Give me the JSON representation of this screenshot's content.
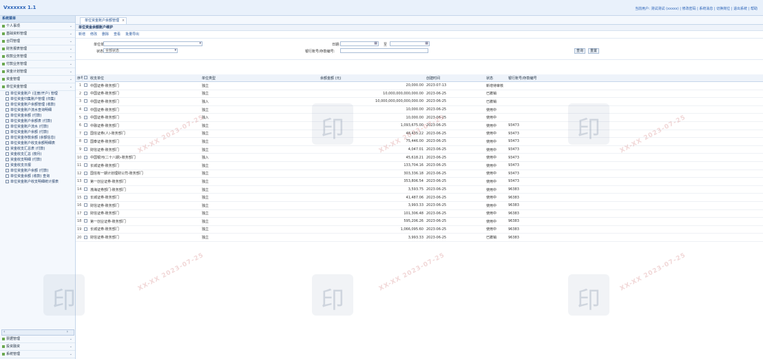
{
  "app": {
    "title": "Vxxxxxx 1.1"
  },
  "top_links": "当前用户: 测试测试 (xxxxx) | 修改密码 | 系统消息 | 切换岗位 | 退出系统 | 帮助",
  "sidebar": {
    "header": "系统菜单",
    "menu": [
      "个人事项",
      "基础资料管理",
      "合同管理",
      "财务报表管理",
      "收款业务管理",
      "付款业务管理",
      "资金计划管理",
      "资金管理",
      "单位资金管理"
    ],
    "submenu": [
      "单位资金账户 (注册/开户) 管理",
      "单位资金归集账户管理 (归集)",
      "单位资金账户余额管理 (收款)",
      "单位资金账户流水查询明细",
      "单位资金余额 (付款)",
      "单位资金账户余额表 (付款)",
      "单位资金账户流水 (付款)",
      "单位资金账户余额 (付款)",
      "单位资金存款余额 (余额信息)",
      "单位资金账户收支余额明细表",
      "资金收支汇总表 (付款)",
      "资金收支汇总 (按月)",
      "资金收支明细 (付款)",
      "资金收支日报",
      "单位资金账户余额 (付款)",
      "单位资金余额 (收款) 查询",
      "单位资金账户收支明细统计报表"
    ],
    "bottom_menu": [
      "票据管理",
      "投资融资",
      "系统管理"
    ]
  },
  "tab": {
    "label": "单位资金账户余额管理"
  },
  "panel_title": "单位资金余额账户维护",
  "toolbar": [
    "新增",
    "修改",
    "删除",
    "查看",
    "批量导出"
  ],
  "form": {
    "unit_label": "单位单位:",
    "unit_value": "",
    "status_label": "状态:",
    "status_value": "全部状态",
    "date_label": "日期:",
    "date_from": "",
    "date_to_sep": "至",
    "date_to": "",
    "account_label": "银行账号/存款编号:",
    "account_value": "",
    "search_label": "查询",
    "reset_label": "重置"
  },
  "table": {
    "headers": [
      "序号",
      "",
      "收支单位",
      "单位类型",
      "余额金额 (元)",
      "创建时间",
      "状态",
      "银行账号/存款编号"
    ],
    "rows": [
      [
        "1",
        "中国证券-账务部门",
        "独立",
        "20,000.00",
        "2023-07-13",
        "新增待审核",
        ""
      ],
      [
        "2",
        "中国证券-账务部门",
        "独立",
        "10,000,000,000,000.00",
        "2023-06-25",
        "已撤销",
        ""
      ],
      [
        "3",
        "中国证券-账务部门",
        "独入",
        "10,000,000,000,000,000.00",
        "2023-06-25",
        "已撤销",
        ""
      ],
      [
        "4",
        "中国证券-账务部门",
        "独立",
        "10,000.00",
        "2023-06-25",
        "使用中",
        ""
      ],
      [
        "5",
        "中国证券-账务部门",
        "独入",
        "10,000.00",
        "2023-06-25",
        "使用中",
        ""
      ],
      [
        "6",
        "中融证券-账务部门",
        "独立",
        "1,093,675.00",
        "2023-06-25",
        "使用中",
        "93473"
      ],
      [
        "7",
        "国信证券(人)-账务部门",
        "独立",
        "48,435.22",
        "2023-06-25",
        "使用中",
        "93473"
      ],
      [
        "8",
        "国泰证券-账务部门",
        "独立",
        "75,446.00",
        "2023-06-25",
        "使用中",
        "93473"
      ],
      [
        "9",
        "财信证券-账务部门",
        "独立",
        "4,047.01",
        "2023-06-25",
        "使用中",
        "93473"
      ],
      [
        "10",
        "中国银河(二十八期)-账务部门",
        "独入",
        "45,618.21",
        "2023-06-25",
        "使用中",
        "93473"
      ],
      [
        "11",
        "长城证券-账务部门",
        "独立",
        "133,704.16",
        "2023-06-25",
        "使用中",
        "93473"
      ],
      [
        "12",
        "国信有一期计划理财公司-账务部门",
        "独立",
        "303,336.18",
        "2023-06-25",
        "使用中",
        "93473"
      ],
      [
        "13",
        "第一创业证券-账务部门",
        "独立",
        "353,806.54",
        "2023-06-25",
        "使用中",
        "93473"
      ],
      [
        "14",
        "渤海证券部门-账务部门",
        "独立",
        "3,593.75",
        "2023-06-25",
        "使用中",
        "96383"
      ],
      [
        "15",
        "长城证券-账务部门",
        "独立",
        "41,487.06",
        "2023-06-25",
        "使用中",
        "96383"
      ],
      [
        "16",
        "财信证券-账务部门",
        "独立",
        "3,993.33",
        "2023-06-25",
        "使用中",
        "96383"
      ],
      [
        "17",
        "财信证券-账务部门",
        "独立",
        "101,306.48",
        "2023-06-25",
        "使用中",
        "96383"
      ],
      [
        "18",
        "第一创业证券-账务部门",
        "独立",
        "595,206.26",
        "2023-06-25",
        "使用中",
        "96383"
      ],
      [
        "19",
        "长城证券-账务部门",
        "独立",
        "1,066,095.60",
        "2023-06-25",
        "使用中",
        "96383"
      ],
      [
        "20",
        "财信证券-账务部门",
        "独立",
        "3,993.33",
        "2023-06-25",
        "已撤销",
        "96383"
      ]
    ]
  },
  "watermark": {
    "glyph": "印",
    "stamp": "XX-XX 2023-07-25"
  }
}
